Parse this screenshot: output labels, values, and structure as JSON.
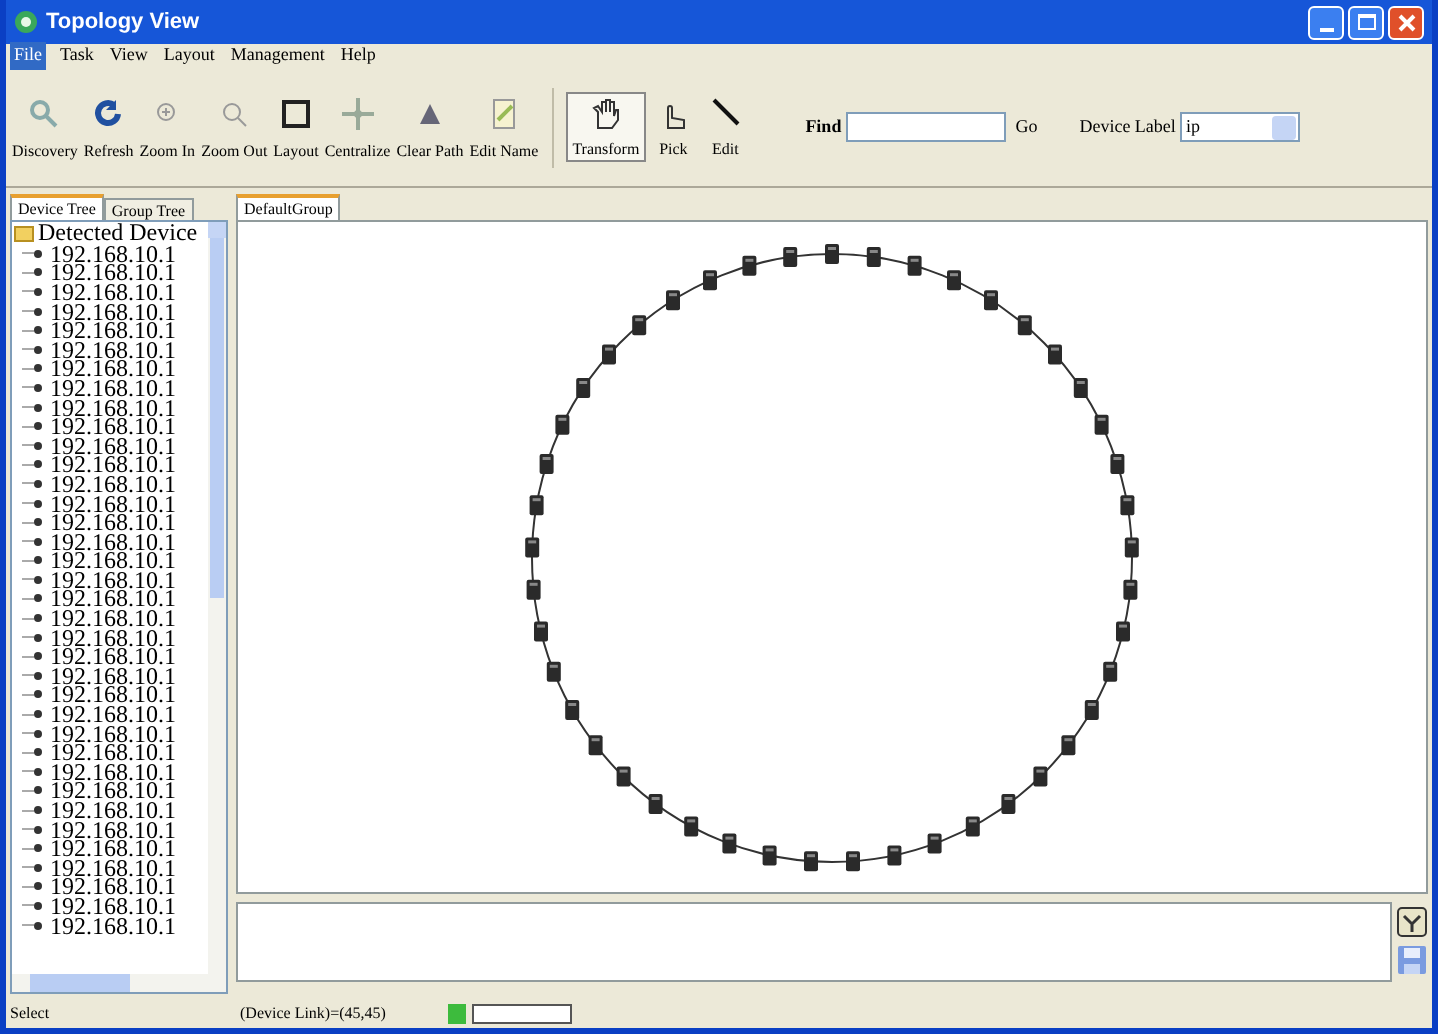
{
  "window": {
    "title": "Topology View"
  },
  "menu": [
    {
      "label": "File",
      "selected": true
    },
    {
      "label": "Task",
      "selected": false
    },
    {
      "label": "View",
      "selected": false
    },
    {
      "label": "Layout",
      "selected": false
    },
    {
      "label": "Management",
      "selected": false
    },
    {
      "label": "Help",
      "selected": false
    }
  ],
  "toolbar": [
    {
      "label": "Discovery"
    },
    {
      "label": "Refresh"
    },
    {
      "label": "Zoom In"
    },
    {
      "label": "Zoom Out"
    },
    {
      "label": "Layout"
    },
    {
      "label": "Centralize"
    },
    {
      "label": "Clear Path"
    },
    {
      "label": "Edit Name"
    }
  ],
  "modes": [
    {
      "label": "Transform",
      "selected": true
    },
    {
      "label": "Pick",
      "selected": false
    },
    {
      "label": "Edit",
      "selected": false
    }
  ],
  "find": {
    "label": "Find",
    "go": "Go"
  },
  "device_label": {
    "label": "Device Label",
    "value": "ip"
  },
  "side_tabs": [
    {
      "label": "Device Tree",
      "selected": true
    },
    {
      "label": "Group Tree",
      "selected": false
    }
  ],
  "tree": {
    "label": "Detected Device",
    "children": [
      "192.168.10.1",
      "192.168.10.1",
      "192.168.10.1",
      "192.168.10.1",
      "192.168.10.1",
      "192.168.10.1",
      "192.168.10.1",
      "192.168.10.1",
      "192.168.10.1",
      "192.168.10.1",
      "192.168.10.1",
      "192.168.10.1",
      "192.168.10.1",
      "192.168.10.1",
      "192.168.10.1",
      "192.168.10.1",
      "192.168.10.1",
      "192.168.10.1",
      "192.168.10.1",
      "192.168.10.1",
      "192.168.10.1",
      "192.168.10.1",
      "192.168.10.1",
      "192.168.10.1",
      "192.168.10.1",
      "192.168.10.1",
      "192.168.10.1",
      "192.168.10.1",
      "192.168.10.1",
      "192.168.10.1",
      "192.168.10.1",
      "192.168.10.1",
      "192.168.10.1",
      "192.168.10.1",
      "192.168.10.1",
      "192.168.10.1"
    ]
  },
  "canvas_tabs": [
    {
      "label": "DefaultGroup",
      "selected": true
    }
  ],
  "status_bar": {
    "mode": "Select",
    "links": "(Device Link)=(45,45)"
  }
}
